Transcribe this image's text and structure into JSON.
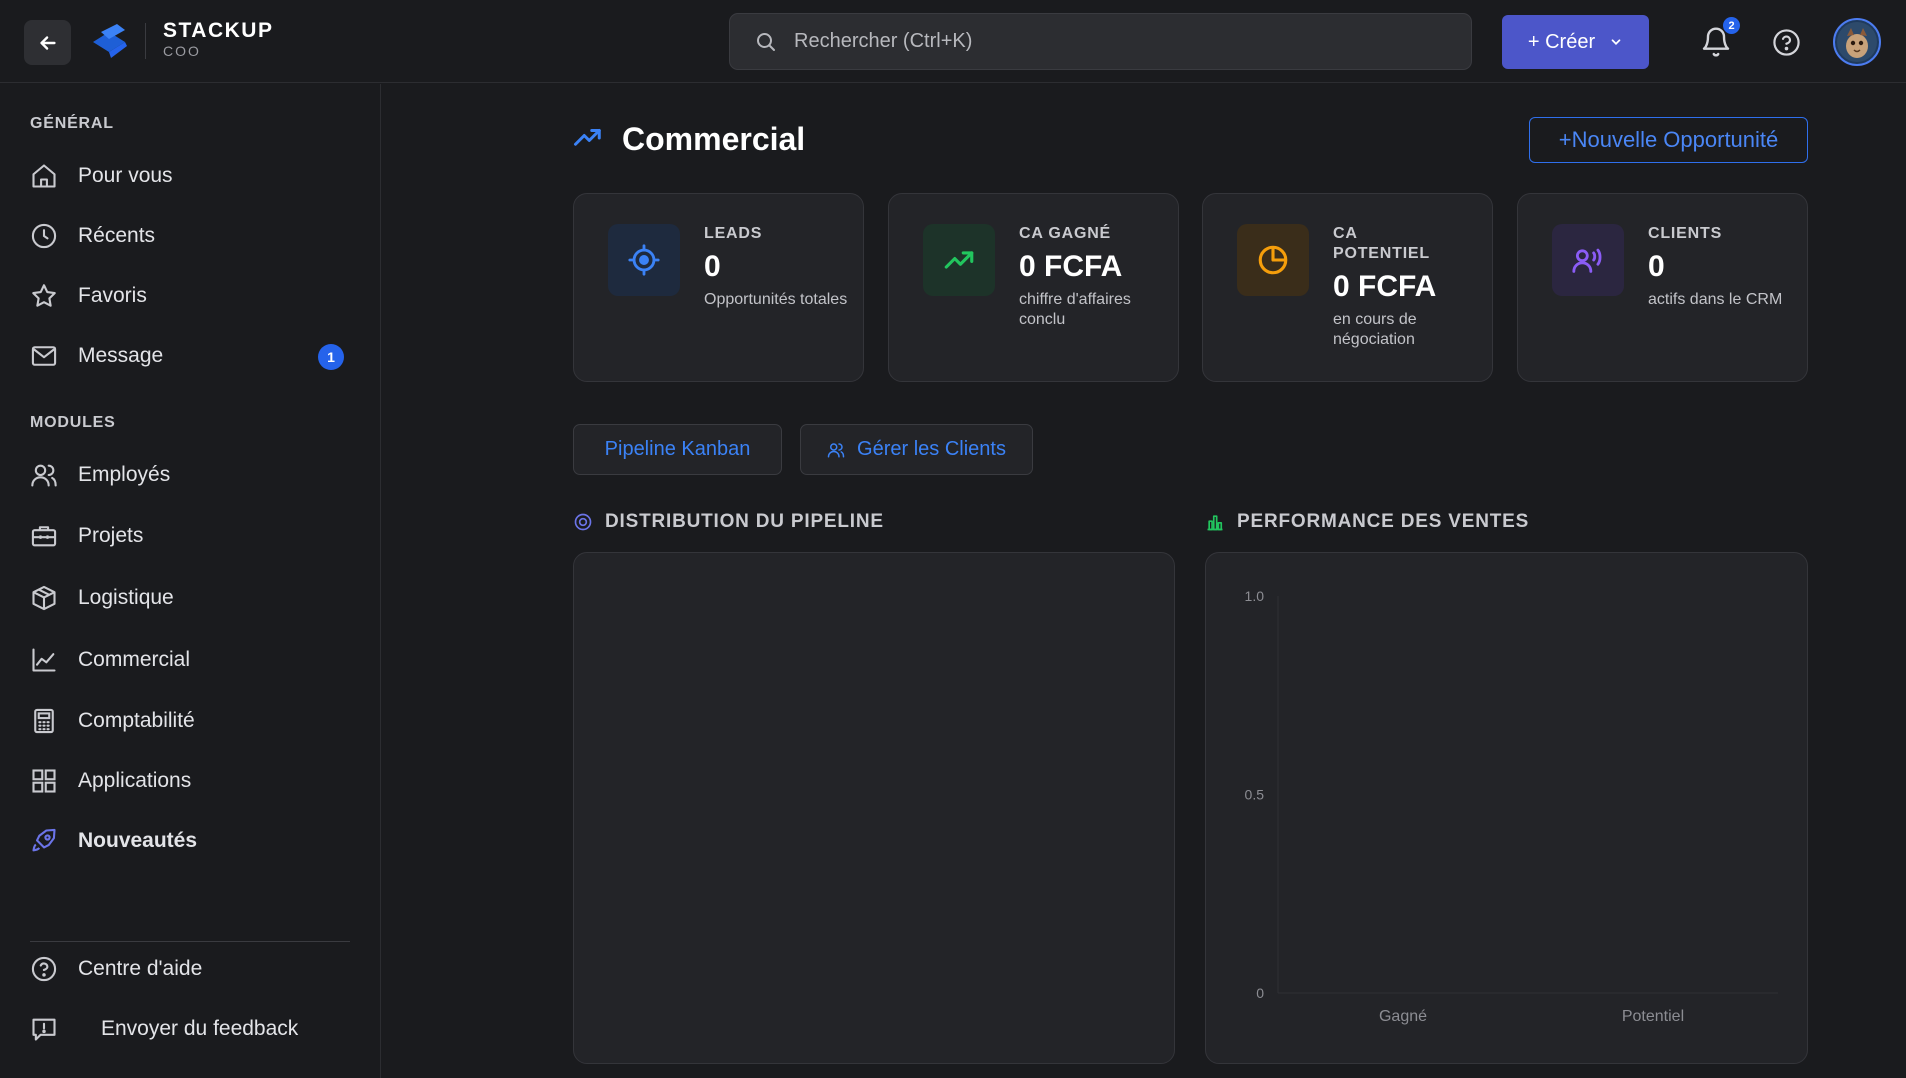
{
  "header": {
    "brand_name": "STACKUP",
    "brand_sub": "COO",
    "search_placeholder": "Rechercher (Ctrl+K)",
    "create_label": "+ Créer",
    "notification_count": "2"
  },
  "sidebar": {
    "general_title": "GÉNÉRAL",
    "general_items": [
      {
        "label": "Pour vous",
        "icon": "home-icon"
      },
      {
        "label": "Récents",
        "icon": "clock-icon"
      },
      {
        "label": "Favoris",
        "icon": "star-icon"
      },
      {
        "label": "Message",
        "icon": "mail-icon",
        "badge": "1"
      }
    ],
    "modules_title": "MODULES",
    "module_items": [
      {
        "label": "Employés",
        "icon": "users-icon"
      },
      {
        "label": "Projets",
        "icon": "briefcase-icon"
      },
      {
        "label": "Logistique",
        "icon": "package-icon"
      },
      {
        "label": "Commercial",
        "icon": "line-chart-icon"
      },
      {
        "label": "Comptabilité",
        "icon": "calculator-icon"
      },
      {
        "label": "Applications",
        "icon": "grid-icon"
      },
      {
        "label": "Nouveautés",
        "icon": "rocket-icon"
      }
    ],
    "footer_items": [
      {
        "label": "Centre d'aide",
        "icon": "help-circle-icon"
      },
      {
        "label": "Envoyer du feedback",
        "icon": "feedback-icon"
      }
    ]
  },
  "page": {
    "title": "Commercial",
    "new_button": "+Nouvelle Opportunité"
  },
  "kpis": [
    {
      "label": "LEADS",
      "value": "0",
      "sub": "Opportunités totales",
      "icon": "target-icon",
      "color": "#3b82f6"
    },
    {
      "label": "CA GAGNÉ",
      "value": "0 FCFA",
      "sub": "chiffre d'affaires conclu",
      "icon": "trending-up-icon",
      "color": "#22c55e"
    },
    {
      "label": "CA POTENTIEL",
      "value": "0 FCFA",
      "sub": "en cours de négociation",
      "icon": "pie-chart-icon",
      "color": "#f59e0b"
    },
    {
      "label": "CLIENTS",
      "value": "0",
      "sub": "actifs dans le CRM",
      "icon": "users-broadcast-icon",
      "color": "#8b5cf6"
    }
  ],
  "tabs": {
    "pipeline": "Pipeline Kanban",
    "clients": "Gérer les Clients"
  },
  "pipeline_chart": {
    "title": "DISTRIBUTION DU PIPELINE"
  },
  "chart_data": {
    "type": "bar",
    "title": "PERFORMANCE DES VENTES",
    "categories": [
      "Gagné",
      "Potentiel"
    ],
    "values": [
      0,
      0
    ],
    "yticks": [
      "0",
      "0.5",
      "1.0"
    ],
    "ylim": [
      0,
      1
    ],
    "grid": false,
    "xlabel": "",
    "ylabel": ""
  }
}
